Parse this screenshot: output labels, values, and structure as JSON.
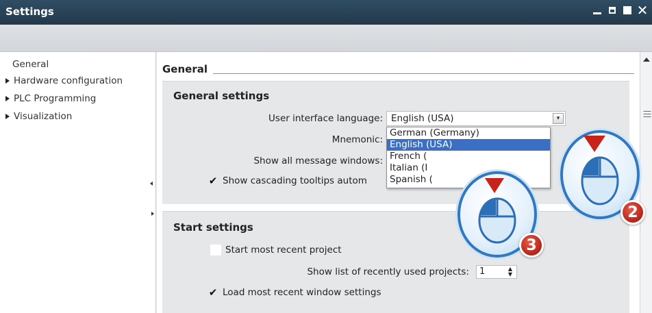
{
  "window": {
    "title": "Settings"
  },
  "sidebar": {
    "items": [
      {
        "label": "General",
        "expandable": false,
        "selected": true
      },
      {
        "label": "Hardware configuration",
        "expandable": true
      },
      {
        "label": "PLC Programming",
        "expandable": true
      },
      {
        "label": "Visualization",
        "expandable": true
      }
    ]
  },
  "content": {
    "section_title": "General",
    "general_settings": {
      "title": "General settings",
      "language_label": "User interface language:",
      "language_value": "English (USA)",
      "language_options": [
        "German (Germany)",
        "English (USA)",
        "French (France)",
        "Italian (Italy)",
        "Spanish (Spain)"
      ],
      "language_options_visible": [
        "German (Germany)",
        "English (USA)",
        "French (",
        "Italian (I",
        "Spanish ("
      ],
      "mnemonic_label": "Mnemonic:",
      "show_messages_label": "Show all message windows:",
      "cascading_tooltips_label": "Show cascading tooltips autom",
      "cascading_tooltips_checked": true
    },
    "start_settings": {
      "title": "Start settings",
      "recent_project_label": "Start most recent project",
      "recent_project_checked": false,
      "recent_list_label": "Show list of recently used projects:",
      "recent_list_value": "1",
      "load_window_label": "Load most recent window settings",
      "load_window_checked": true
    }
  },
  "callouts": {
    "step2": "2",
    "step3": "3"
  },
  "colors": {
    "titlebar": "#2f4d63",
    "selection": "#3a6fc4",
    "callout_ring": "#3278c0",
    "badge": "#c8291c"
  }
}
